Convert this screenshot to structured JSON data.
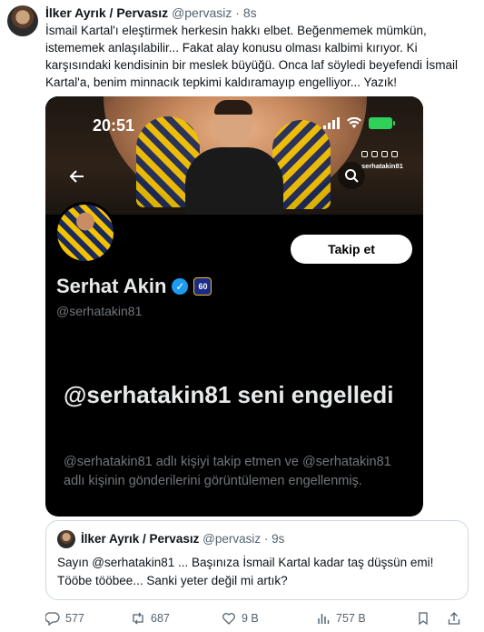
{
  "tweet": {
    "author_name": "İlker Ayrık / Pervasız",
    "handle": "@pervasiz",
    "separator": "·",
    "time": "8s",
    "text": "İsmail Kartal'ı eleştirmek herkesin hakkı elbet. Beğenmemek mümkün, istememek anlaşılabilir... Fakat alay konusu olması kalbimi kırıyor. Ki karşısındaki kendisinin bir meslek büyüğü. Onca laf söyledi beyefendi İsmail Kartal'a, benim minnacık tepkimi kaldıramayıp engelliyor... Yazık!"
  },
  "screenshot_card": {
    "clock": "20:51",
    "social_handle": "serhatakin81",
    "follow_label": "Takip et",
    "profile_name": "Serhat Akin",
    "badge_text": "60",
    "profile_handle": "@serhatakin81",
    "blocked_title": "@serhatakin81 seni engelledi",
    "blocked_desc": "@serhatakin81 adlı kişiyi takip etmen ve @serhatakin81 adlı kişinin gönderilerini görüntülemen engellenmiş."
  },
  "quote": {
    "author_name": "İlker Ayrık / Pervasız",
    "handle": "@pervasiz",
    "separator": "·",
    "time": "9s",
    "text": "Sayın @serhatakin81 ... Başınıza İsmail Kartal kadar taş düşsün emi! Tööbe tööbee... Sanki yeter değil mi artık?"
  },
  "actions": {
    "replies": "577",
    "reposts": "687",
    "likes": "9 B",
    "views": "757 B"
  },
  "colors": {
    "accent": "#1d9bf0",
    "text_primary": "#0f1419",
    "text_muted": "#536471",
    "battery": "#30d158"
  },
  "icons": [
    "reply-icon",
    "repost-icon",
    "like-icon",
    "views-icon",
    "bookmark-icon",
    "share-icon",
    "back-arrow-icon",
    "search-icon",
    "verified-icon"
  ]
}
